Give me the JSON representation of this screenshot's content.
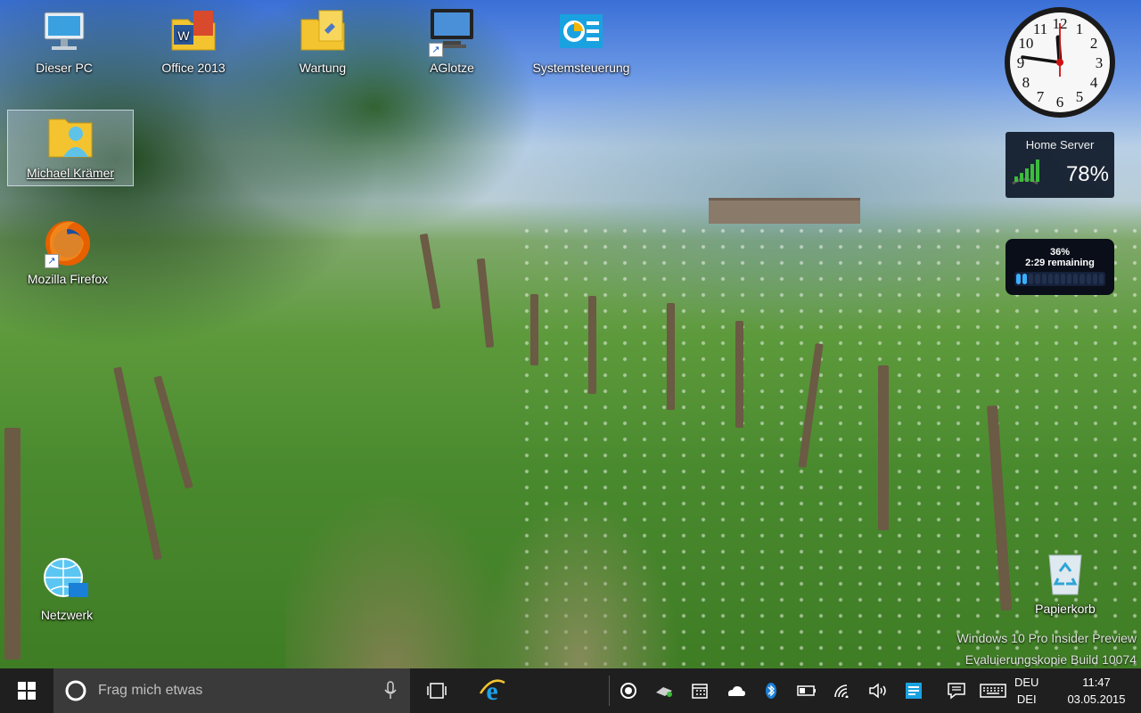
{
  "desktop_icons": [
    {
      "label": "Dieser PC",
      "icon": "computer-icon"
    },
    {
      "label": "Office 2013",
      "icon": "office-folder-icon"
    },
    {
      "label": "Wartung",
      "icon": "folder-icon"
    },
    {
      "label": "AGlotze",
      "icon": "monitor-icon"
    },
    {
      "label": "Systemsteuerung",
      "icon": "control-panel-icon"
    },
    {
      "label": "Michael Krämer",
      "icon": "user-folder-icon"
    },
    {
      "label": "Mozilla Firefox",
      "icon": "firefox-icon"
    },
    {
      "label": "Netzwerk",
      "icon": "network-icon"
    },
    {
      "label": "Papierkorb",
      "icon": "recycle-bin-icon"
    }
  ],
  "clock_gadget": {
    "numerals": [
      "12",
      "1",
      "2",
      "3",
      "4",
      "5",
      "6",
      "7",
      "8",
      "9",
      "10",
      "11"
    ]
  },
  "home_server_gadget": {
    "title": "Home Server",
    "value": "78%",
    "signal_level": 0.78
  },
  "battery_gadget": {
    "percent_label": "36%",
    "remaining_label": "2:29 remaining",
    "level": 0.36
  },
  "watermark": {
    "line1": "Windows 10 Pro Insider Preview",
    "line2": "Evaluierungskopie Build 10074"
  },
  "taskbar": {
    "search_placeholder": "Frag mich etwas",
    "tray_icons": [
      "record-icon",
      "network-adapter-icon",
      "calendar-icon",
      "onedrive-icon",
      "bluetooth-icon",
      "battery-icon",
      "wifi-icon",
      "volume-icon",
      "app-tray-icon",
      "notification-icon",
      "keyboard-icon"
    ],
    "language_line1": "DEU",
    "language_line2": "DEI",
    "time": "11:47",
    "date": "03.05.2015"
  },
  "colors": {
    "taskbar": "#1f1f1f",
    "search_box": "#3a3a3a",
    "accent": "#1a7fd6"
  }
}
